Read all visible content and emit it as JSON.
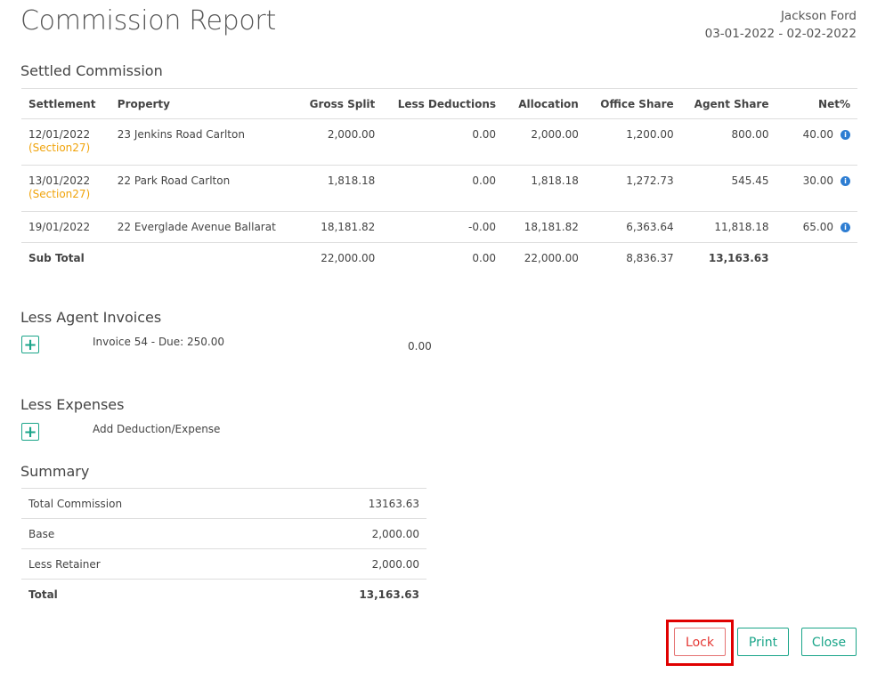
{
  "header": {
    "title": "Commission Report",
    "agent": "Jackson Ford",
    "date_range": "03-01-2022 - 02-02-2022"
  },
  "settled": {
    "title": "Settled Commission",
    "columns": [
      "Settlement",
      "Property",
      "Gross Split",
      "Less Deductions",
      "Allocation",
      "Office Share",
      "Agent Share",
      "Net%"
    ],
    "rows": [
      {
        "date": "12/01/2022",
        "tag": "(Section27)",
        "property": "23 Jenkins Road Carlton",
        "gross": "2,000.00",
        "deductions": "0.00",
        "allocation": "2,000.00",
        "office": "1,200.00",
        "agent": "800.00",
        "net": "40.00"
      },
      {
        "date": "13/01/2022",
        "tag": "(Section27)",
        "property": "22 Park Road Carlton",
        "gross": "1,818.18",
        "deductions": "0.00",
        "allocation": "1,818.18",
        "office": "1,272.73",
        "agent": "545.45",
        "net": "30.00"
      },
      {
        "date": "19/01/2022",
        "tag": "",
        "property": "22 Everglade Avenue Ballarat",
        "gross": "18,181.82",
        "deductions": "-0.00",
        "allocation": "18,181.82",
        "office": "6,363.64",
        "agent": "11,818.18",
        "net": "65.00"
      }
    ],
    "subtotal": {
      "label": "Sub Total",
      "gross": "22,000.00",
      "deductions": "0.00",
      "allocation": "22,000.00",
      "office": "8,836.37",
      "agent": "13,163.63"
    }
  },
  "agent_invoices": {
    "title": "Less Agent Invoices",
    "items": [
      {
        "label": "Invoice 54 - Due: 250.00",
        "value": "0.00"
      }
    ]
  },
  "expenses": {
    "title": "Less Expenses",
    "add_label": "Add Deduction/Expense"
  },
  "summary": {
    "title": "Summary",
    "rows": [
      {
        "label": "Total Commission",
        "value": "13163.63"
      },
      {
        "label": "Base",
        "value": "2,000.00"
      },
      {
        "label": "Less Retainer",
        "value": "2,000.00"
      }
    ],
    "total": {
      "label": "Total",
      "value": "13,163.63"
    }
  },
  "buttons": {
    "lock": "Lock",
    "print": "Print",
    "close": "Close"
  },
  "icons": {
    "info": "info-icon",
    "add": "plus-icon"
  },
  "colors": {
    "accent": "#1aa589",
    "warning_tag": "#f0a30a",
    "info": "#2d7dd2",
    "lock": "#e53935",
    "highlight": "#e00000"
  }
}
